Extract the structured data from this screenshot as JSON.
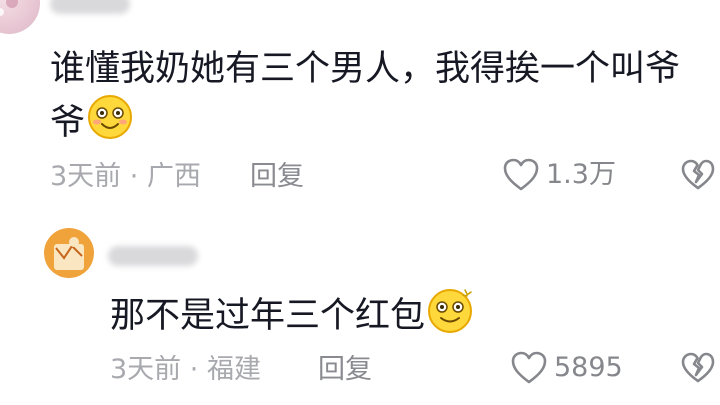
{
  "comments": [
    {
      "text_line1": "谁懂我奶她有三个男人，我得挨一个叫爷",
      "text_line2": "爷",
      "emoji": "smile-emoji",
      "time": "3天前",
      "location": "广西",
      "reply_label": "回复",
      "likes": "1.3万"
    },
    {
      "text_line1": "那不是过年三个红包",
      "emoji": "dizzy-smile-emoji",
      "time": "3天前",
      "location": "福建",
      "reply_label": "回复",
      "likes": "5895"
    }
  ],
  "icons": {
    "like": "heart-outline-icon",
    "dislike": "broken-heart-icon"
  },
  "colors": {
    "text": "#161823",
    "meta": "#a8a9ae",
    "icon": "#86878c"
  }
}
